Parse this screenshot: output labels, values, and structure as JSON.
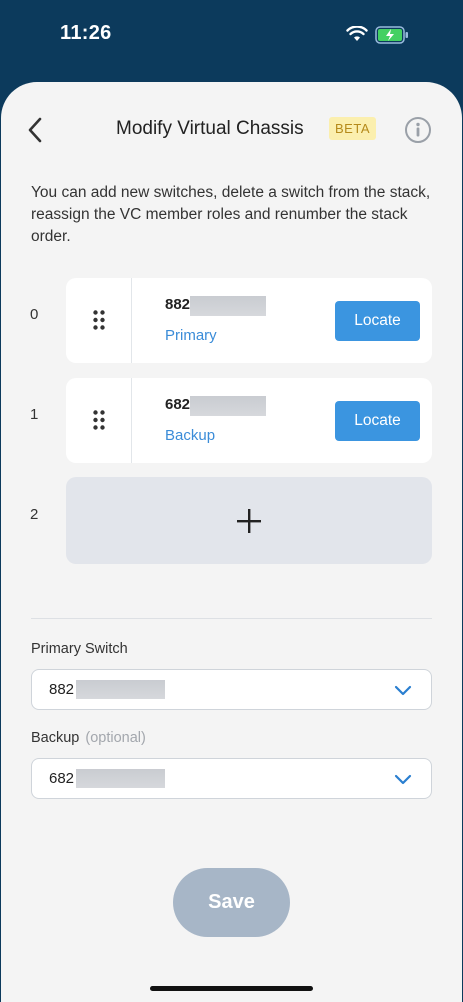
{
  "status_bar": {
    "time": "11:26",
    "icons": [
      "wifi-icon",
      "battery-charging-icon"
    ]
  },
  "header": {
    "title": "Modify Virtual Chassis",
    "badge": "BETA",
    "icons": [
      "back-icon",
      "info-icon"
    ]
  },
  "description": "You can add new switches, delete a switch from the stack, reassign the VC member roles and renumber the stack order.",
  "members": [
    {
      "index": "0",
      "serial": "882",
      "role": "Primary",
      "locate_label": "Locate"
    },
    {
      "index": "1",
      "serial": "682",
      "role": "Backup",
      "locate_label": "Locate"
    }
  ],
  "add_slot": {
    "index": "2",
    "icon": "plus-icon"
  },
  "primary_switch": {
    "label": "Primary Switch",
    "value": "882"
  },
  "backup": {
    "label": "Backup",
    "optional": "(optional)",
    "value": "682"
  },
  "save_label": "Save",
  "colors": {
    "header_bg": "#0c3a5c",
    "accent": "#3b95e0",
    "beta_bg": "#fbefae",
    "save_disabled": "#a7b6c7"
  }
}
